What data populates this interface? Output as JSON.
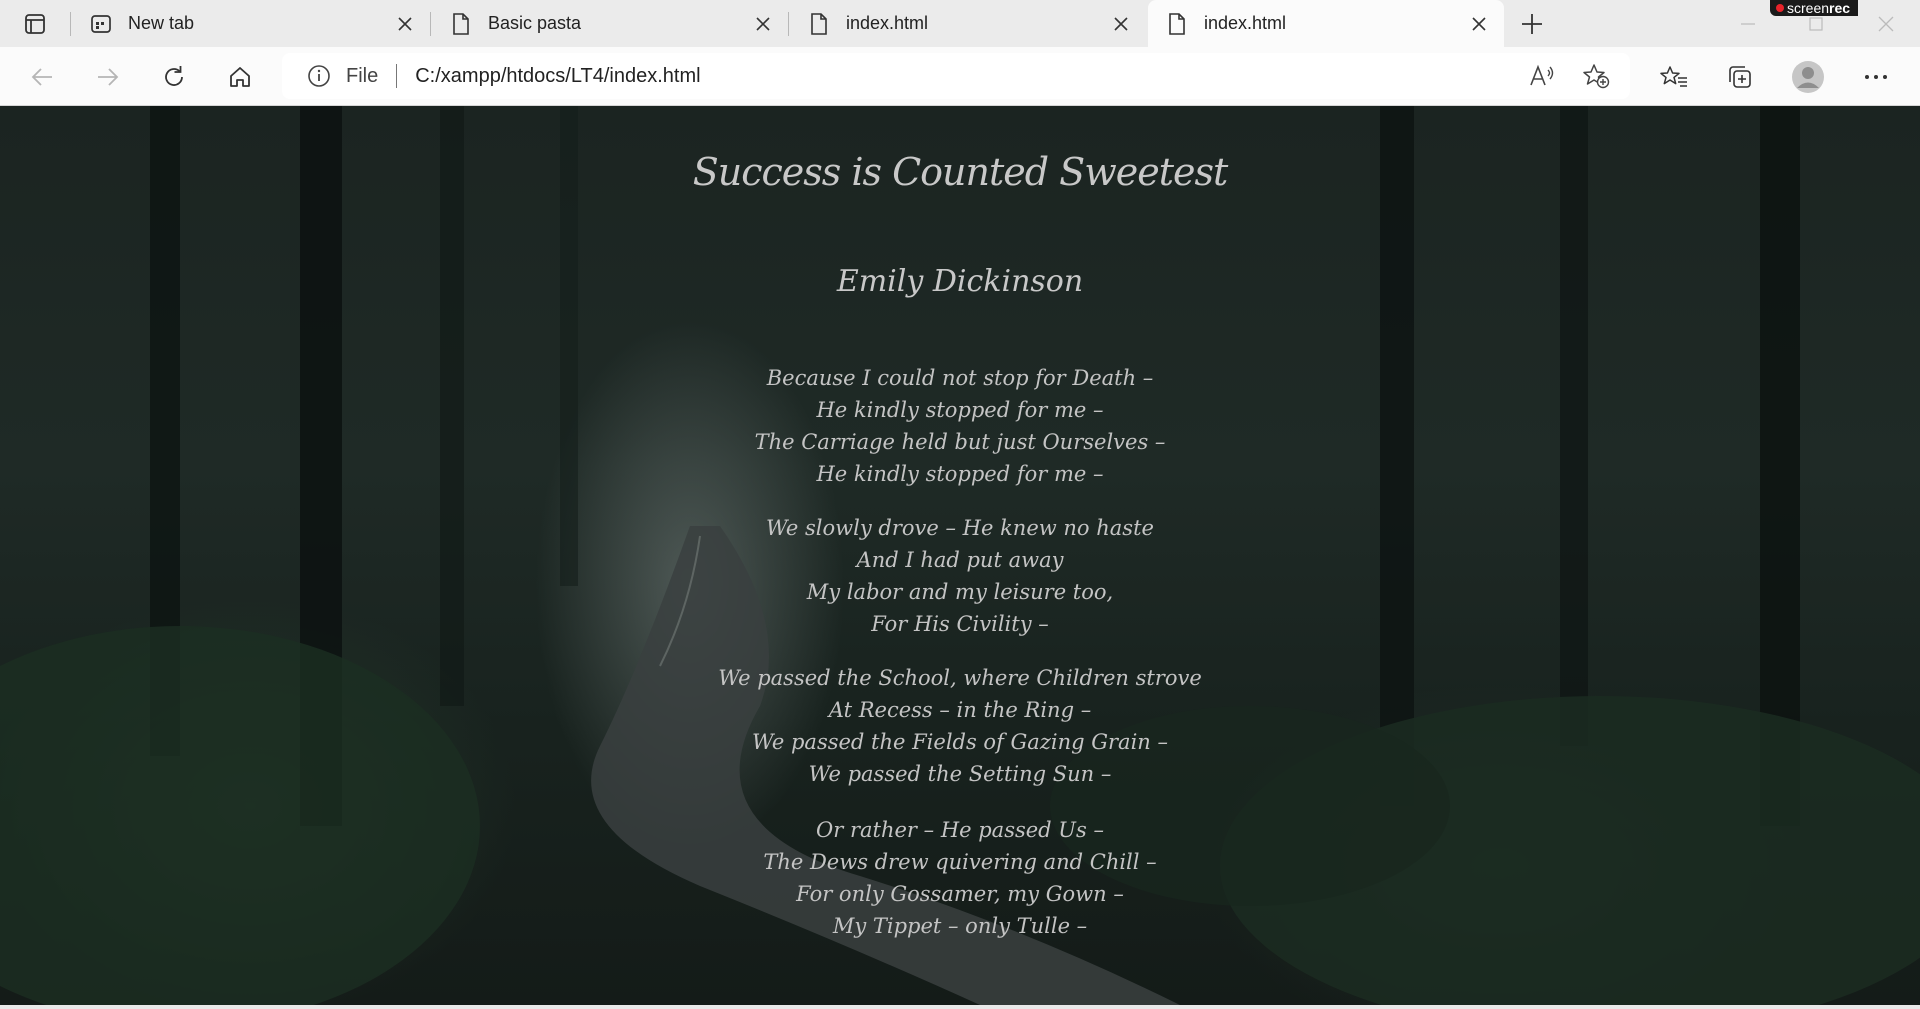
{
  "browser": {
    "tabs": [
      {
        "title": "New tab",
        "icon": "newtab-icon",
        "active": false
      },
      {
        "title": "Basic pasta",
        "icon": "file-icon",
        "active": false
      },
      {
        "title": "index.html",
        "icon": "file-icon",
        "active": false
      },
      {
        "title": "index.html",
        "icon": "file-icon",
        "active": true
      }
    ],
    "address": {
      "scheme": "File",
      "url": "C:/xampp/htdocs/LT4/index.html"
    },
    "recorder_badge": {
      "prefix": "screen",
      "suffix": "rec"
    }
  },
  "page": {
    "title": "Success is Counted Sweetest",
    "author": "Emily Dickinson",
    "stanzas": [
      [
        "Because I could not stop for Death –",
        "He kindly stopped for me –",
        "The Carriage held but just Ourselves –",
        "He kindly stopped for me –"
      ],
      [
        "We slowly drove – He knew no haste",
        "And I had put away",
        "My labor and my leisure too,",
        "For His Civility –"
      ],
      [
        "We passed the School, where Children strove",
        "At Recess – in the Ring –",
        "We passed the Fields of Gazing Grain –",
        "We passed the Setting Sun –"
      ],
      [
        "Or rather – He passed Us –",
        "The Dews drew quivering and Chill –",
        "For only Gossamer, my Gown –",
        "My Tippet – only Tulle –"
      ]
    ]
  },
  "colors": {
    "text": "#c8c8c8",
    "background": "#1c2623",
    "tabstrip": "#ebebeb",
    "toolbar": "#fbfbfb"
  }
}
